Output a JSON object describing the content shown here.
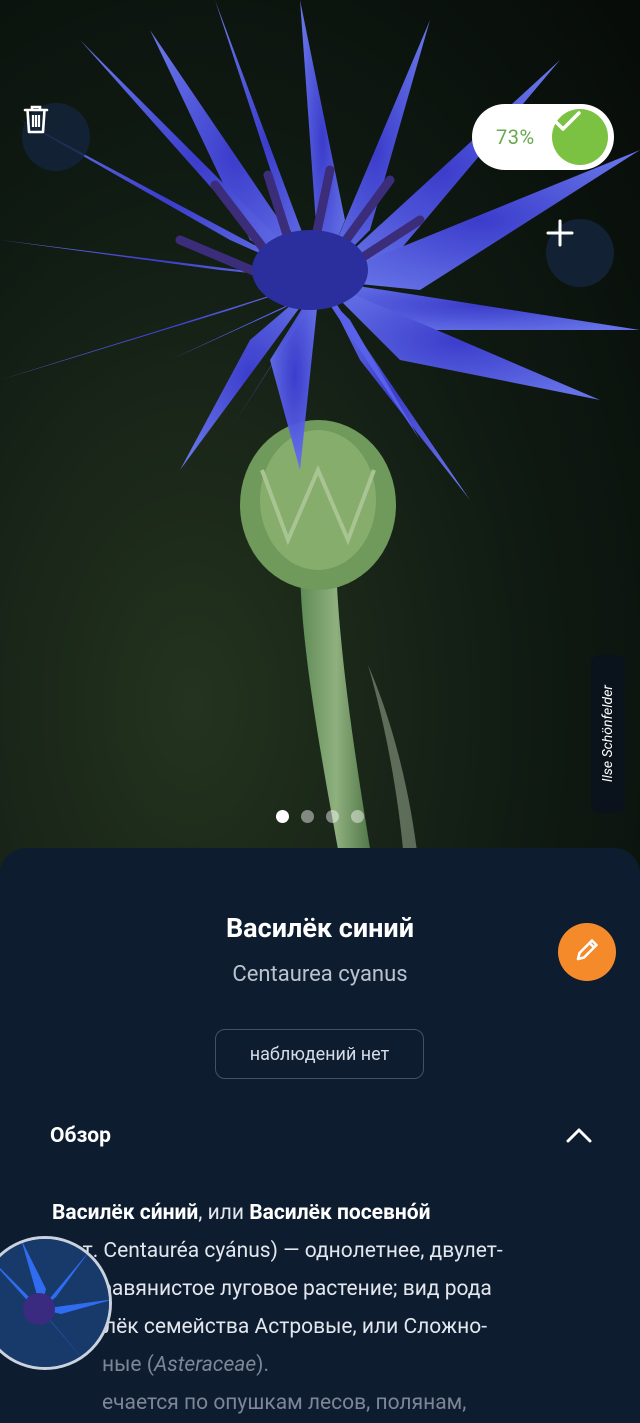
{
  "photo": {
    "author": "Ilse Schönfelder",
    "slide_count": 4,
    "active_slide": 1
  },
  "match": {
    "percent_label": "73%",
    "percent": 73
  },
  "species": {
    "common_name": "Василёк синий",
    "scientific_name": "Centaurea cyanus"
  },
  "observations": {
    "chip_label": "наблюдений нет"
  },
  "overview": {
    "label": "Обзор",
    "expanded": true,
    "description": {
      "name1": "Василёк си́ний",
      "connector1": ", или ",
      "name2": "Василёк посевно́й",
      "line1_rest": "(лат. Centauréa cyánus) — однолетнее, двулет-",
      "line2": "травянистое луговое растение; вид рода",
      "line3": "лёк семейства Астровые, или Сложно-",
      "line4_start": "ные (",
      "line4_family": "Asteraceae",
      "line4_end": ").",
      "line5": "ечается по опушкам лесов, полянам,"
    }
  },
  "icons": {
    "delete": "trash-icon",
    "add": "plus-icon",
    "confirm": "check-icon",
    "edit": "pencil-icon",
    "collapse": "chevron-up-icon"
  },
  "colors": {
    "sheet_background": "#0e1c30",
    "accent_green": "#7cc242",
    "accent_orange": "#f58a2b",
    "match_text": "#6aa84f"
  }
}
